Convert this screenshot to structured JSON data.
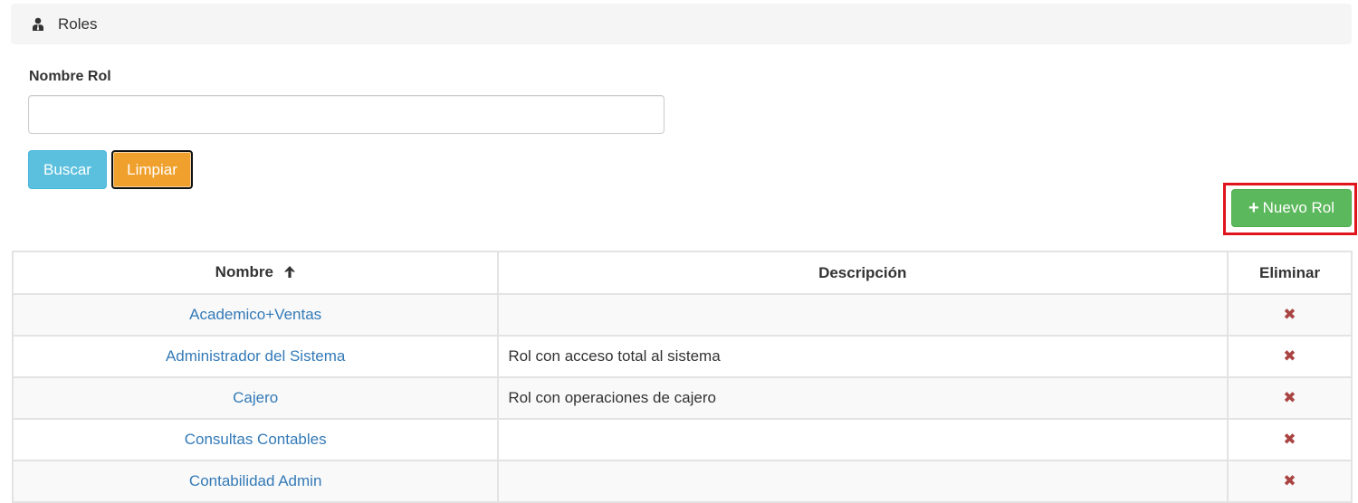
{
  "breadcrumb": {
    "icon": "user-tie-icon",
    "title": "Roles"
  },
  "search_form": {
    "label": "Nombre Rol",
    "input_value": "",
    "input_placeholder": "",
    "search_label": "Buscar",
    "clear_label": "Limpiar"
  },
  "actions": {
    "new_label": "Nuevo Rol",
    "new_icon": "plus-icon"
  },
  "table": {
    "columns": [
      "Nombre",
      "Descripción",
      "Eliminar"
    ],
    "sort_icon": "arrow-up-icon",
    "rows": [
      {
        "name": "Academico+Ventas",
        "description": "",
        "delete": "✖"
      },
      {
        "name": "Administrador del Sistema",
        "description": "Rol con acceso total al sistema",
        "delete": "✖"
      },
      {
        "name": "Cajero",
        "description": "Rol con operaciones de cajero",
        "delete": "✖"
      },
      {
        "name": "Consultas Contables",
        "description": "",
        "delete": "✖"
      },
      {
        "name": "Contabilidad Admin",
        "description": "",
        "delete": "✖"
      }
    ]
  },
  "colors": {
    "search_button": "#5bc0de",
    "clear_button": "#f0a02c",
    "new_button": "#5cb85c",
    "link": "#337ab7",
    "delete": "#a94442",
    "highlight": "#e0141c"
  }
}
